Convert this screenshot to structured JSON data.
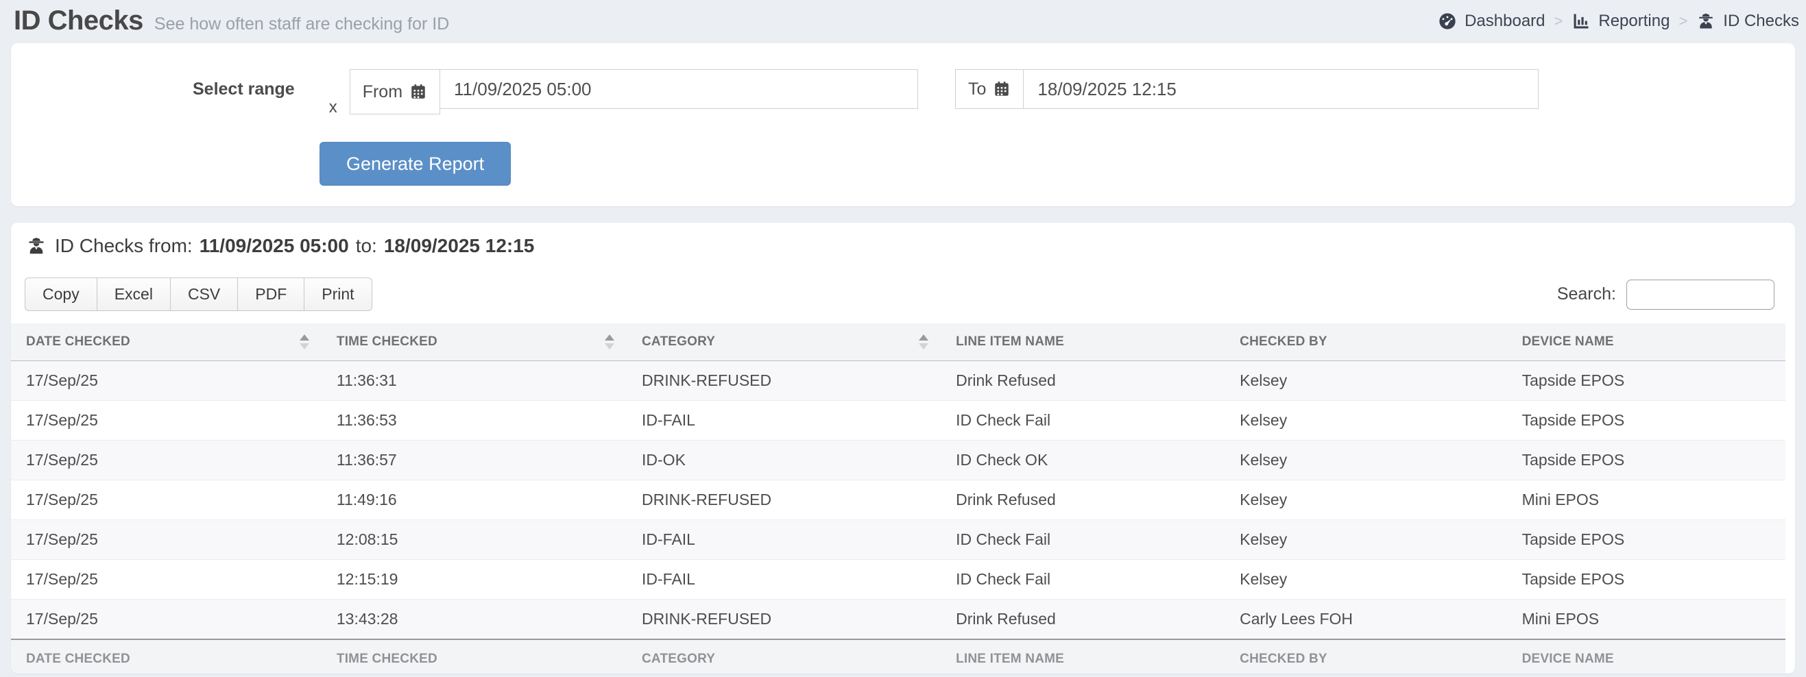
{
  "page": {
    "title": "ID Checks",
    "subtitle": "See how often staff are checking for ID"
  },
  "breadcrumb": {
    "separator": ">",
    "items": [
      {
        "label": "Dashboard",
        "icon": "dashboard-gauge-icon"
      },
      {
        "label": "Reporting",
        "icon": "bar-chart-icon"
      },
      {
        "label": "ID Checks",
        "icon": "spy-icon"
      }
    ]
  },
  "filter": {
    "label": "Select range",
    "clear_label": "x",
    "from": {
      "label": "From",
      "icon": "calendar-icon",
      "value": "11/09/2025 05:00"
    },
    "to": {
      "label": "To",
      "icon": "calendar-icon",
      "value": "18/09/2025 12:15"
    },
    "generate_label": "Generate Report"
  },
  "report": {
    "heading": {
      "icon": "spy-icon",
      "prefix": "ID Checks from:",
      "from_value": "11/09/2025 05:00",
      "to_word": "to:",
      "to_value": "18/09/2025 12:15"
    },
    "export_buttons": [
      "Copy",
      "Excel",
      "CSV",
      "PDF",
      "Print"
    ],
    "search": {
      "label": "Search:",
      "value": ""
    },
    "table": {
      "columns": [
        {
          "label": "DATE CHECKED",
          "sortable": true
        },
        {
          "label": "TIME CHECKED",
          "sortable": true
        },
        {
          "label": "CATEGORY",
          "sortable": true
        },
        {
          "label": "LINE ITEM NAME",
          "sortable": false
        },
        {
          "label": "CHECKED BY",
          "sortable": false
        },
        {
          "label": "DEVICE NAME",
          "sortable": false
        }
      ],
      "rows": [
        [
          "17/Sep/25",
          "11:36:31",
          "DRINK-REFUSED",
          "Drink Refused",
          "Kelsey",
          "Tapside EPOS"
        ],
        [
          "17/Sep/25",
          "11:36:53",
          "ID-FAIL",
          "ID Check Fail",
          "Kelsey",
          "Tapside EPOS"
        ],
        [
          "17/Sep/25",
          "11:36:57",
          "ID-OK",
          "ID Check OK",
          "Kelsey",
          "Tapside EPOS"
        ],
        [
          "17/Sep/25",
          "11:49:16",
          "DRINK-REFUSED",
          "Drink Refused",
          "Kelsey",
          "Mini EPOS"
        ],
        [
          "17/Sep/25",
          "12:08:15",
          "ID-FAIL",
          "ID Check Fail",
          "Kelsey",
          "Tapside EPOS"
        ],
        [
          "17/Sep/25",
          "12:15:19",
          "ID-FAIL",
          "ID Check Fail",
          "Kelsey",
          "Tapside EPOS"
        ],
        [
          "17/Sep/25",
          "13:43:28",
          "DRINK-REFUSED",
          "Drink Refused",
          "Carly Lees FOH",
          "Mini EPOS"
        ]
      ]
    }
  },
  "colors": {
    "accent_blue": "#5b8fc7",
    "page_background": "#ebeef3",
    "table_header_bg": "#f3f4f6",
    "row_stripe": "#f8f8fa"
  }
}
